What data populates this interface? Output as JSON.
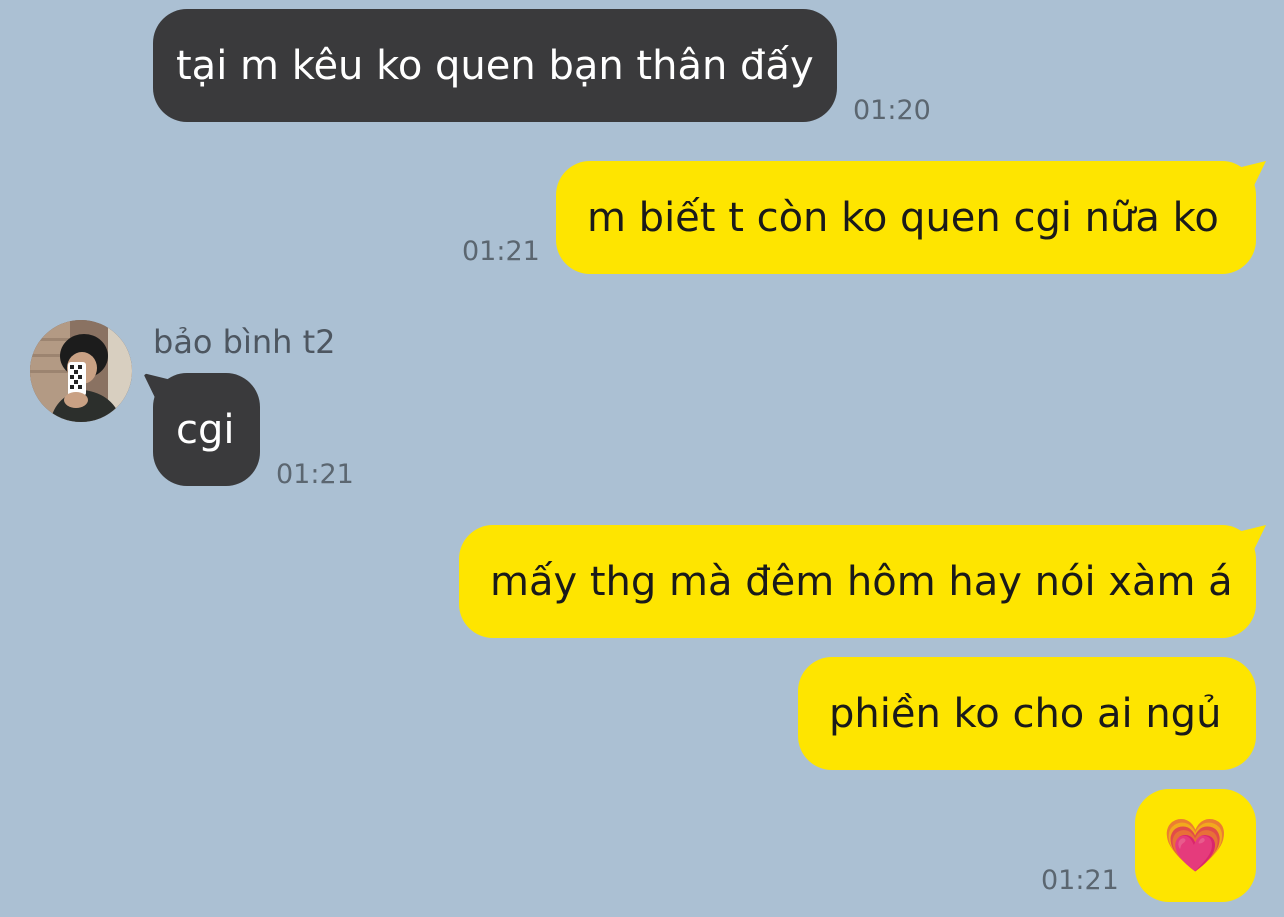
{
  "messages": [
    {
      "text": "tại m kêu ko quen bạn thân đấy",
      "time": "01:20"
    },
    {
      "text": "m biết t còn ko quen cgi nữa ko",
      "time": "01:21"
    },
    {
      "sender": "bảo bình t2",
      "text": "cgi",
      "time": "01:21"
    },
    {
      "text": "mấy thg mà đêm hôm hay nói xàm á"
    },
    {
      "text": "phiền ko cho ai ngủ"
    },
    {
      "text": "💗",
      "time": "01:21"
    }
  ],
  "colors": {
    "background": "#abc0d3",
    "incoming_bubble": "#3a3a3c",
    "outgoing_bubble": "#fee500"
  }
}
